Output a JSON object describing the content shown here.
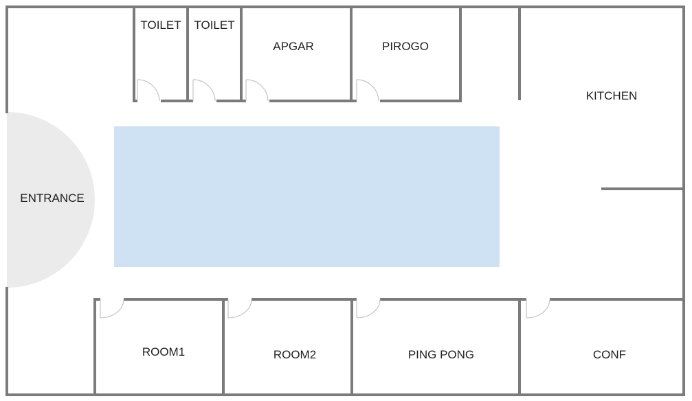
{
  "floor_plan": {
    "colors": {
      "wall": "#7b7b7b",
      "background": "#ffffff",
      "open_area": "#cfe2f3",
      "entrance": "#ebebeb",
      "door": "#c4c4c4",
      "text": "#1f1f1f"
    },
    "rooms": {
      "toilet_1": "TOILET",
      "toilet_2": "TOILET",
      "apgar": "APGAR",
      "pirogo": "PIROGO",
      "kitchen": "KITCHEN",
      "entrance": "ENTRANCE",
      "room1": "ROOM1",
      "room2": "ROOM2",
      "ping_pong": "PING PONG",
      "conf": "CONF"
    }
  }
}
